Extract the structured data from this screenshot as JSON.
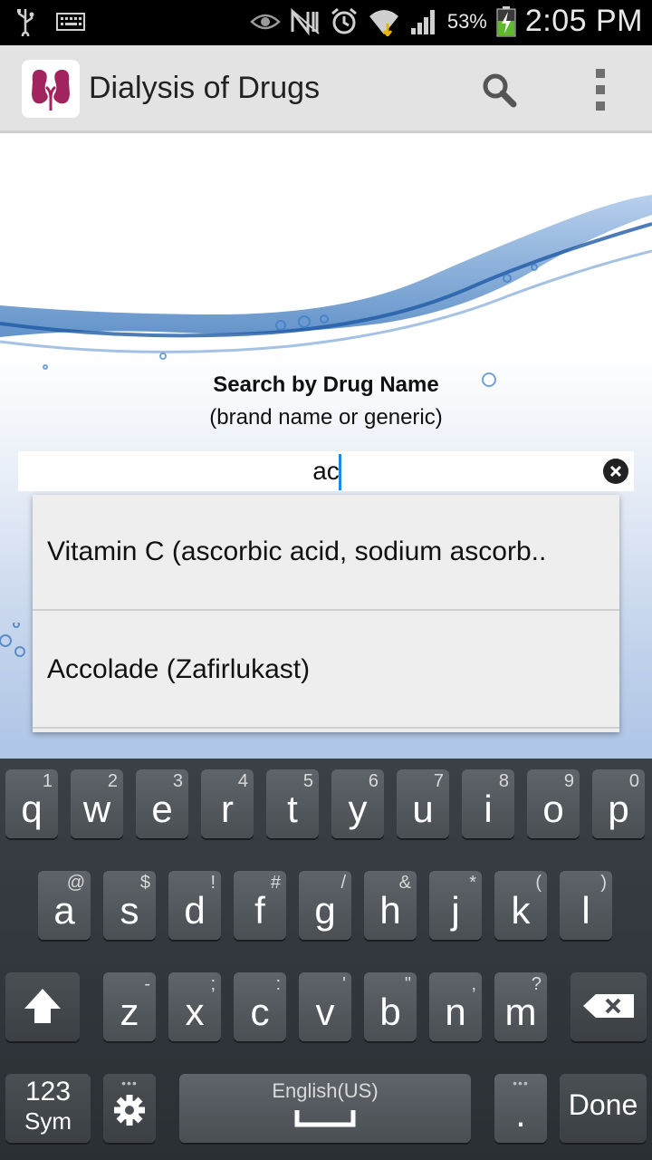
{
  "status_bar": {
    "battery_percent": "53%",
    "time": "2:05 PM",
    "icons": [
      "usb-icon",
      "keyboard-icon",
      "eye-icon",
      "nfc-icon",
      "alarm-icon",
      "wifi-icon",
      "signal-icon",
      "battery-charging-icon"
    ]
  },
  "action_bar": {
    "title": "Dialysis of Drugs",
    "logo_icon": "kidney-logo-icon",
    "search_icon": "search-icon",
    "overflow_icon": "overflow-menu-icon"
  },
  "main": {
    "search_title": "Search by Drug Name",
    "search_subtitle": "(brand name or generic)",
    "search_value": "ac",
    "suggestions": [
      "Vitamin C (ascorbic acid, sodium ascorb..",
      "Accolade (Zafirlukast)"
    ]
  },
  "keyboard": {
    "row1": [
      {
        "main": "q",
        "sec": "1"
      },
      {
        "main": "w",
        "sec": "2"
      },
      {
        "main": "e",
        "sec": "3"
      },
      {
        "main": "r",
        "sec": "4"
      },
      {
        "main": "t",
        "sec": "5"
      },
      {
        "main": "y",
        "sec": "6"
      },
      {
        "main": "u",
        "sec": "7"
      },
      {
        "main": "i",
        "sec": "8"
      },
      {
        "main": "o",
        "sec": "9"
      },
      {
        "main": "p",
        "sec": "0"
      }
    ],
    "row2": [
      {
        "main": "a",
        "sec": "@"
      },
      {
        "main": "s",
        "sec": "$"
      },
      {
        "main": "d",
        "sec": "!"
      },
      {
        "main": "f",
        "sec": "#"
      },
      {
        "main": "g",
        "sec": "/"
      },
      {
        "main": "h",
        "sec": "&"
      },
      {
        "main": "j",
        "sec": "*"
      },
      {
        "main": "k",
        "sec": "("
      },
      {
        "main": "l",
        "sec": ")"
      }
    ],
    "row3": [
      {
        "main": "z",
        "sec": "-"
      },
      {
        "main": "x",
        "sec": ";"
      },
      {
        "main": "c",
        "sec": ":"
      },
      {
        "main": "v",
        "sec": "'"
      },
      {
        "main": "b",
        "sec": "\""
      },
      {
        "main": "n",
        "sec": ","
      },
      {
        "main": "m",
        "sec": "?"
      }
    ],
    "sym_label_top": "123",
    "sym_label_bottom": "Sym",
    "space_language": "English(US)",
    "period": ".",
    "done": "Done"
  }
}
